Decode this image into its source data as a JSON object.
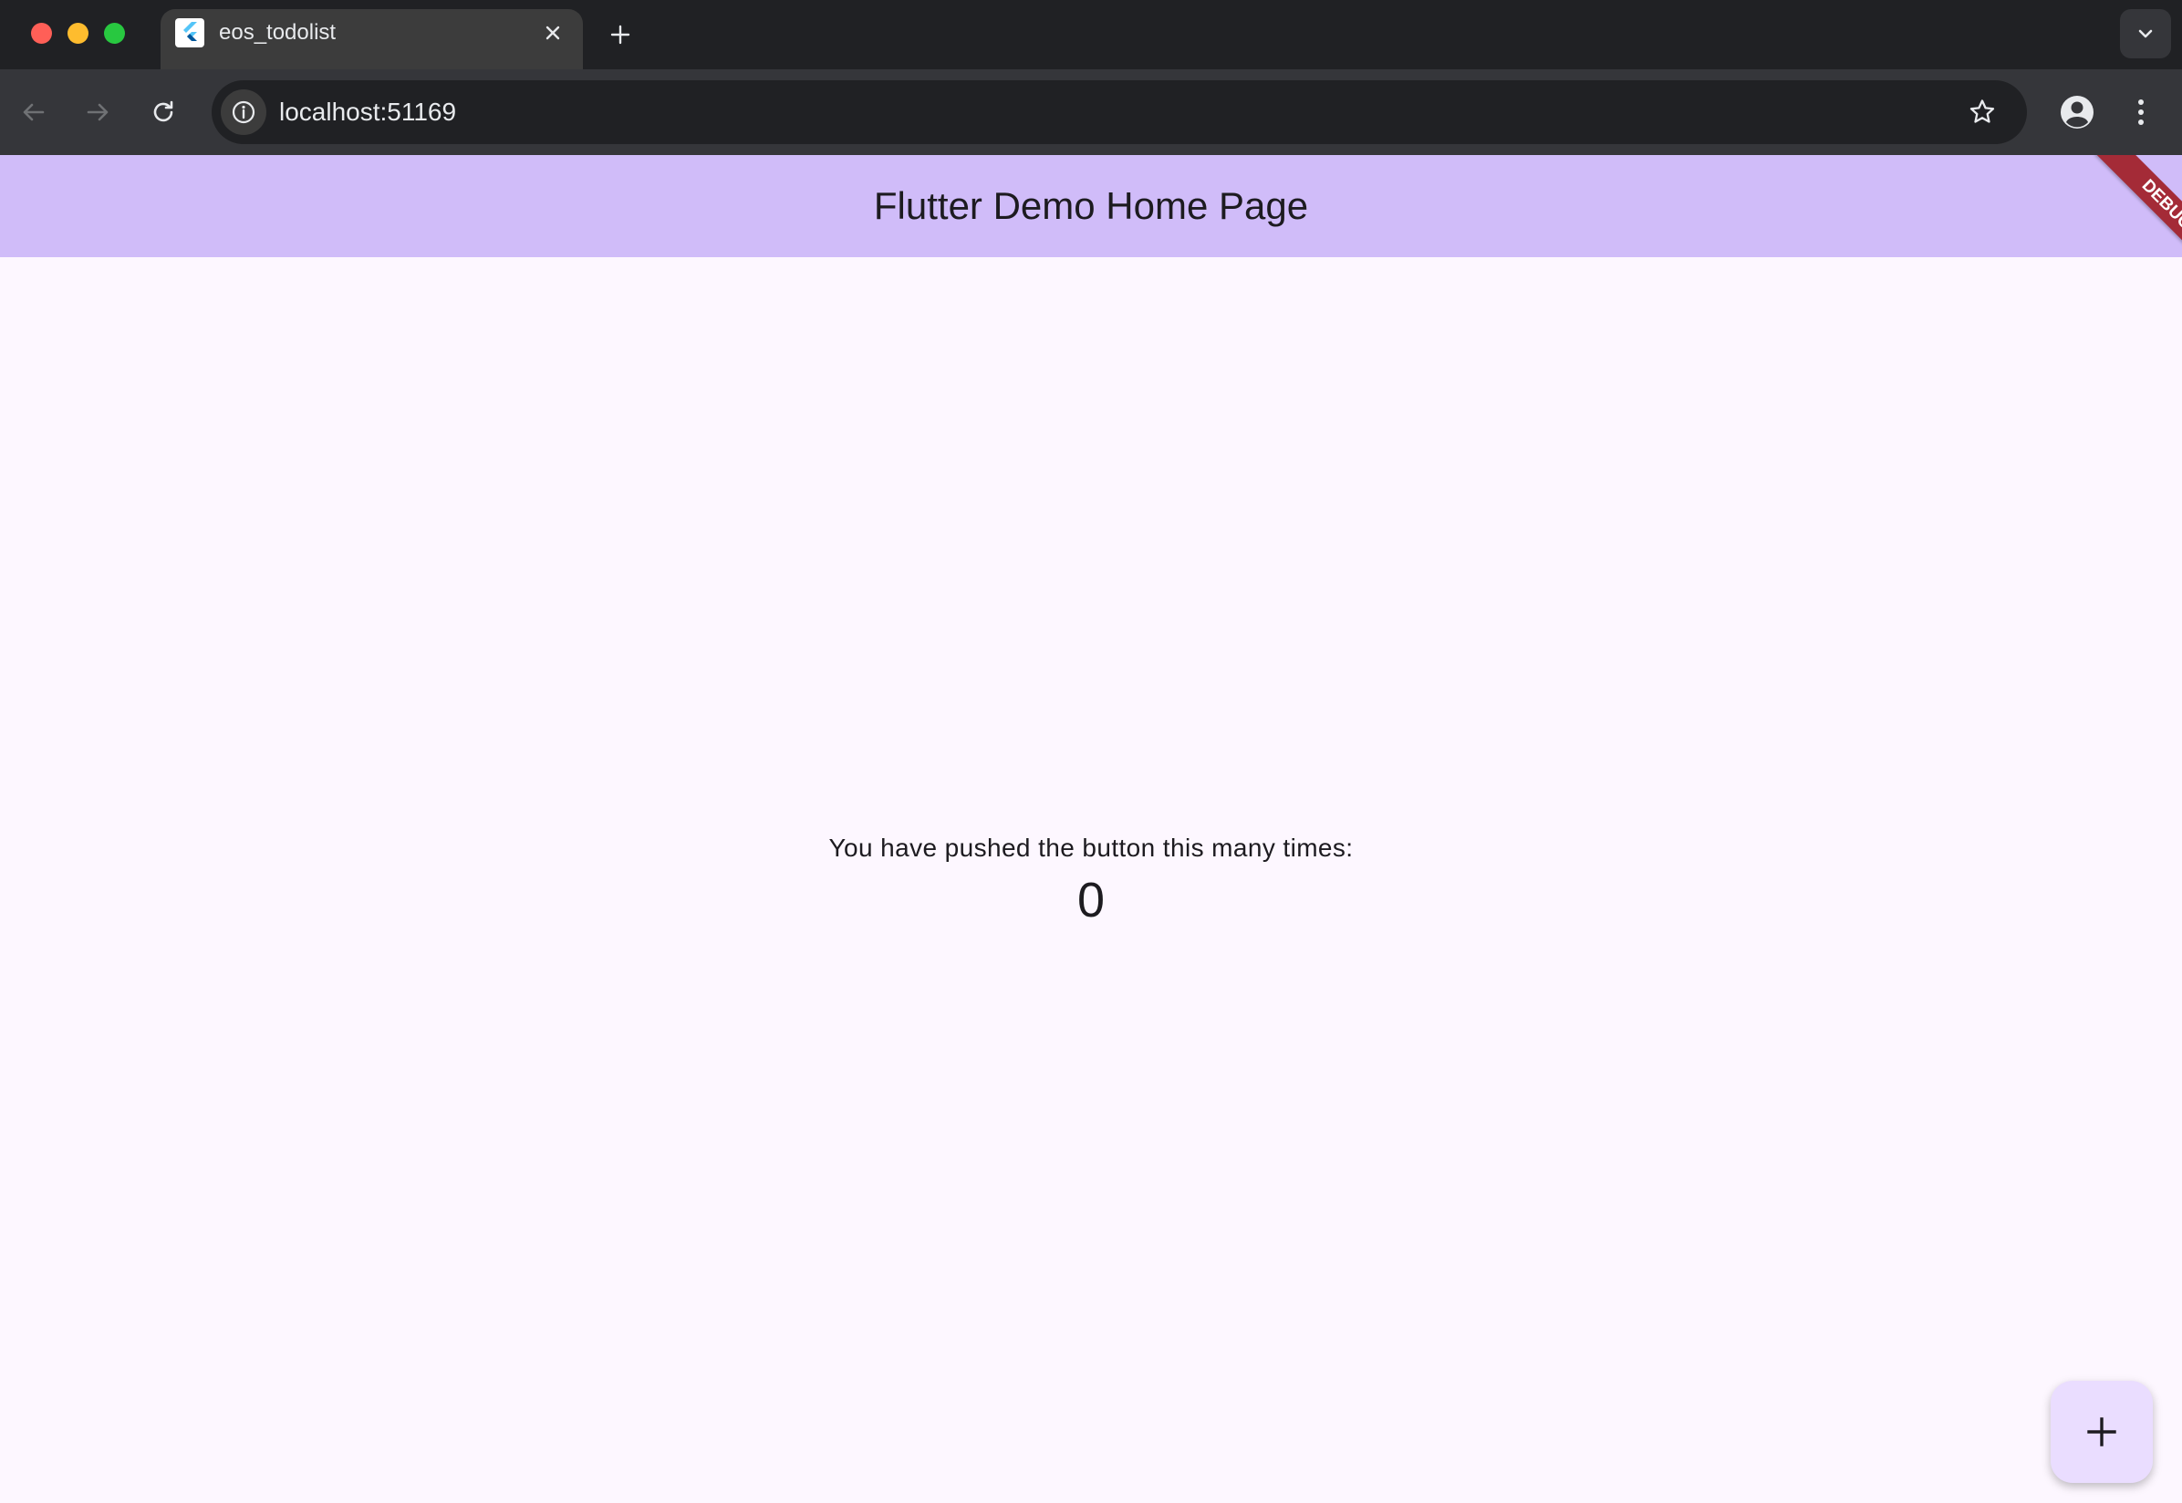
{
  "browser": {
    "tab": {
      "title": "eos_todolist"
    },
    "omnibox": {
      "url": "localhost:51169"
    }
  },
  "app": {
    "appbar": {
      "title": "Flutter Demo Home Page",
      "background": "#d0bcf9"
    },
    "debug_banner": "DEBUG",
    "counter": {
      "label": "You have pushed the button this many times:",
      "value": "0"
    },
    "fab": {
      "icon": "plus-icon",
      "background": "#eaddff"
    }
  },
  "icons": {
    "favicon": "flutter-logo-icon",
    "tab_close": "close-icon",
    "new_tab": "plus-icon",
    "tab_search": "chevron-down-icon",
    "back": "arrow-left-icon",
    "forward": "arrow-right-icon",
    "reload": "reload-icon",
    "site_info": "info-icon",
    "bookmark": "star-icon",
    "profile": "profile-icon",
    "menu": "more-vertical-icon"
  }
}
